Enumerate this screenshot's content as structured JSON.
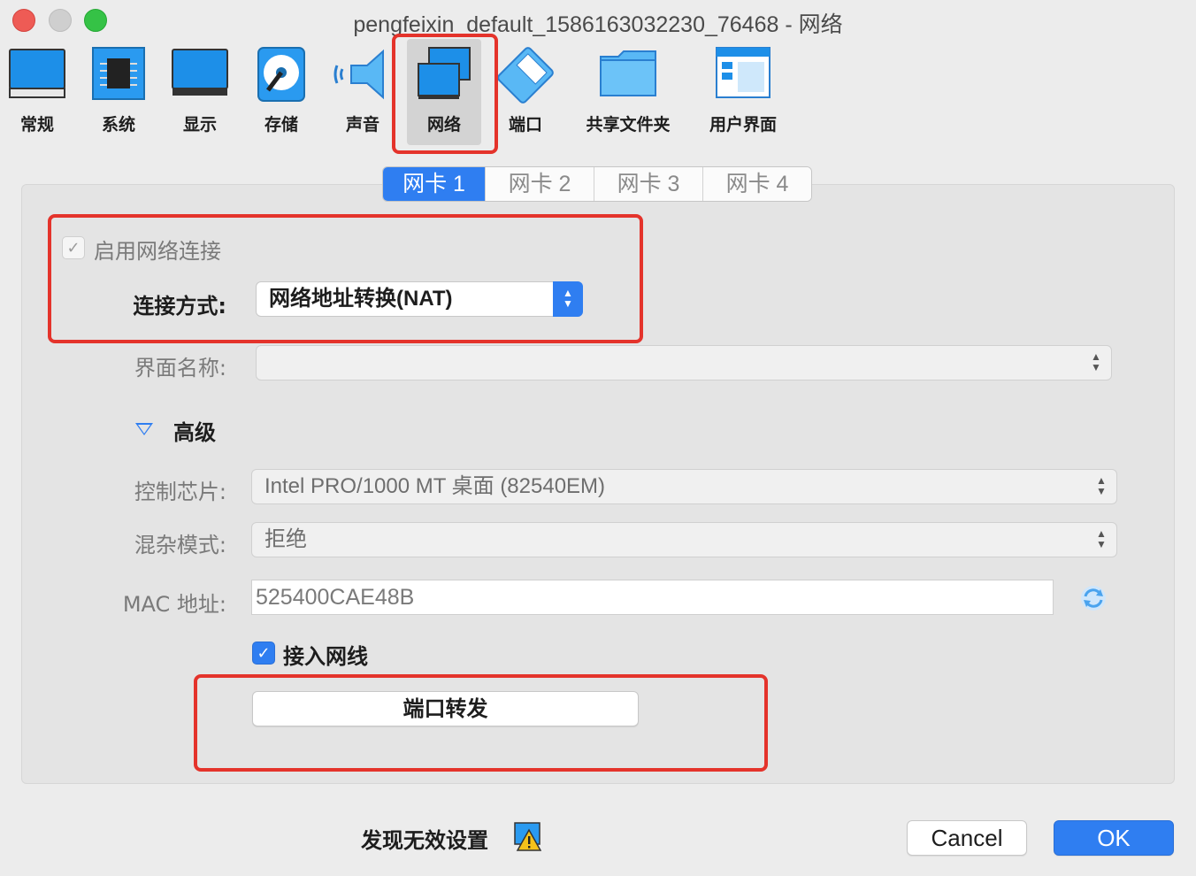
{
  "window": {
    "title": "pengfeixin_default_1586163032230_76468 - 网络"
  },
  "toolbar": {
    "items": [
      {
        "label": "常规",
        "icon": "general-monitor-icon"
      },
      {
        "label": "系统",
        "icon": "chip-icon"
      },
      {
        "label": "显示",
        "icon": "display-icon"
      },
      {
        "label": "存储",
        "icon": "disk-icon"
      },
      {
        "label": "声音",
        "icon": "speaker-icon"
      },
      {
        "label": "网络",
        "icon": "network-icon",
        "selected": true
      },
      {
        "label": "端口",
        "icon": "serial-port-icon"
      },
      {
        "label": "共享文件夹",
        "icon": "folder-icon"
      },
      {
        "label": "用户界面",
        "icon": "user-interface-icon"
      }
    ]
  },
  "tabs": [
    {
      "label": "网卡 1",
      "active": true
    },
    {
      "label": "网卡 2"
    },
    {
      "label": "网卡 3"
    },
    {
      "label": "网卡 4"
    }
  ],
  "adapter": {
    "enable_label": "启用网络连接",
    "attached_label": "连接方式:",
    "attached_value": "网络地址转换(NAT)",
    "name_label": "界面名称:",
    "name_value": "",
    "advanced_label": "高级",
    "chipset_label": "控制芯片:",
    "chipset_value": "Intel PRO/1000 MT 桌面 (82540EM)",
    "promisc_label": "混杂模式:",
    "promisc_value": "拒绝",
    "mac_label": "MAC 地址:",
    "mac_value": "525400CAE48B",
    "cable_label": "接入网线",
    "port_forward_label": "端口转发"
  },
  "footer": {
    "invalid_label": "发现无效设置",
    "cancel_label": "Cancel",
    "ok_label": "OK"
  },
  "colors": {
    "accent": "#2f7ef1",
    "highlight": "#e4332b"
  }
}
